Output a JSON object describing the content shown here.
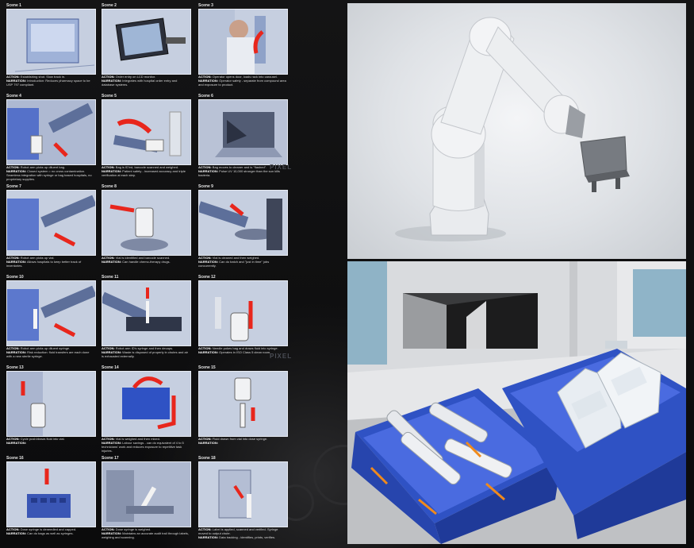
{
  "storyboard": {
    "watermark": "PIXEL",
    "scenes": [
      {
        "title": "Scene 1",
        "action": "Establishing shot.  Slow track in.",
        "narration": "Introduction:  Reduces pharmacy space to be USP 797 compliant."
      },
      {
        "title": "Scene 2",
        "action": "Order entry on LCD monitor.",
        "narration": "Integrates with hospital order entry and database systems."
      },
      {
        "title": "Scene 3",
        "action": "Operator opens door, loads rack into carousel.",
        "narration": "Operator safety - separate from compound area and exposure to product."
      },
      {
        "title": "Scene 4",
        "action": "Robot arm picks up diluent bag.",
        "narration": "Closed system = no cross contamination.  Seamless integration with syringe or bag based hospitals, no proprietary supplies."
      },
      {
        "title": "Scene 5",
        "action": "Bag is ID'ed, barcode scanned and weighed.",
        "narration": "Patient safety - increased accuracy and triple verification at each step."
      },
      {
        "title": "Scene 6",
        "action": "Bag moves to cleaner and is \"flashed\".",
        "narration": "Pulse UV 10,000 stronger than the sun kills bacteria."
      },
      {
        "title": "Scene 7",
        "action": "Robot arm picks up vial.",
        "narration": "Allows hospitals to keep better track of inventories."
      },
      {
        "title": "Scene 8",
        "action": "Vial is identified and barcode scanned.",
        "narration": "Can handle chemo-therapy drugs."
      },
      {
        "title": "Scene 9",
        "action": "Vial is cleaned and then weighed.",
        "narration": "Can do batch and \"just in time\" jobs concurrently."
      },
      {
        "title": "Scene 10",
        "action": "Robot arm picks up diluent syringe.",
        "narration": "Risk reduction:  fluid transfers are each done with a new sterile syringe."
      },
      {
        "title": "Scene 11",
        "action": "Robot arm ID's syringe and then decaps.",
        "narration": "Waste is disposed of properly in chutes and air is exhausted externally."
      },
      {
        "title": "Scene 12",
        "action": "Needle pokes bag and draws fluid into syringe.",
        "narration": "Operates in ISO Class 5 clean room."
      },
      {
        "title": "Scene 13",
        "action": "Cycle push/draws fluid into vial.",
        "narration": ""
      },
      {
        "title": "Scene 14",
        "action": "Vial is weighed and then mixed.",
        "narration": "Labour savings - can do equivalent of 4 to 5 technicians' work and reduces exposure to repetitive task injuries."
      },
      {
        "title": "Scene 15",
        "action": "Fluid drawn from vial into dose syringe.",
        "narration": ""
      },
      {
        "title": "Scene 16",
        "action": "Dose syringe is deneedled and capped.",
        "narration": "Can do bags as well as syringes."
      },
      {
        "title": "Scene 17",
        "action": "Dose syringe is weighed.",
        "narration": "Maintains an accurate audit trail through labels, weighing and scanning."
      },
      {
        "title": "Scene 18",
        "action": "Label is applied, scanned and verified.  Syringe moved to output chute.",
        "narration": "Data tracking - identifies, prints, verifies."
      }
    ],
    "labels": {
      "action": "ACTION:",
      "narration": "NARRATION:"
    }
  },
  "colors": {
    "panel": "#c6cfe0",
    "blue": "#2f52c4",
    "red": "#e8261c",
    "robot": "#eceef0"
  }
}
